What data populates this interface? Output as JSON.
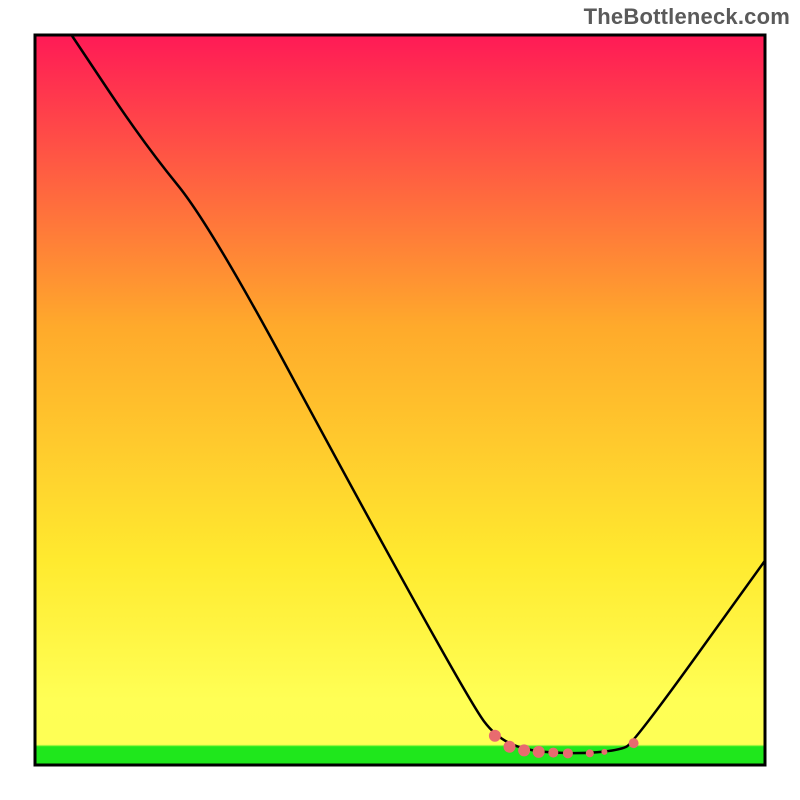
{
  "attribution": "TheBottleneck.com",
  "chart_data": {
    "type": "line",
    "title": "",
    "xlabel": "",
    "ylabel": "",
    "xlim": [
      0,
      100
    ],
    "ylim": [
      0,
      100
    ],
    "curve": [
      {
        "x": 5,
        "y": 100
      },
      {
        "x": 15,
        "y": 85
      },
      {
        "x": 24,
        "y": 74
      },
      {
        "x": 45,
        "y": 35
      },
      {
        "x": 60,
        "y": 8
      },
      {
        "x": 63,
        "y": 4
      },
      {
        "x": 67,
        "y": 2
      },
      {
        "x": 74,
        "y": 1.5
      },
      {
        "x": 80,
        "y": 2
      },
      {
        "x": 82,
        "y": 3
      },
      {
        "x": 100,
        "y": 28
      }
    ],
    "markers": [
      {
        "x": 63,
        "y": 4,
        "r": 6
      },
      {
        "x": 65,
        "y": 2.5,
        "r": 6
      },
      {
        "x": 67,
        "y": 2,
        "r": 6
      },
      {
        "x": 69,
        "y": 1.8,
        "r": 6
      },
      {
        "x": 71,
        "y": 1.7,
        "r": 5
      },
      {
        "x": 73,
        "y": 1.6,
        "r": 5
      },
      {
        "x": 76,
        "y": 1.6,
        "r": 4
      },
      {
        "x": 78,
        "y": 1.8,
        "r": 3
      },
      {
        "x": 82,
        "y": 3,
        "r": 5
      }
    ],
    "green_band": {
      "y0": 0,
      "y1": 2.5
    },
    "yellow_band": {
      "y0": 2.5,
      "y1": 9
    },
    "colors": {
      "curve": "#000000",
      "marker": "#e86b6f",
      "frame": "#000000",
      "green": "#1fe71c",
      "yellow": "#feff55",
      "gradient_top": "#ff1a56",
      "gradient_mid": "#ffaa2b",
      "gradient_low": "#ffff55"
    }
  }
}
